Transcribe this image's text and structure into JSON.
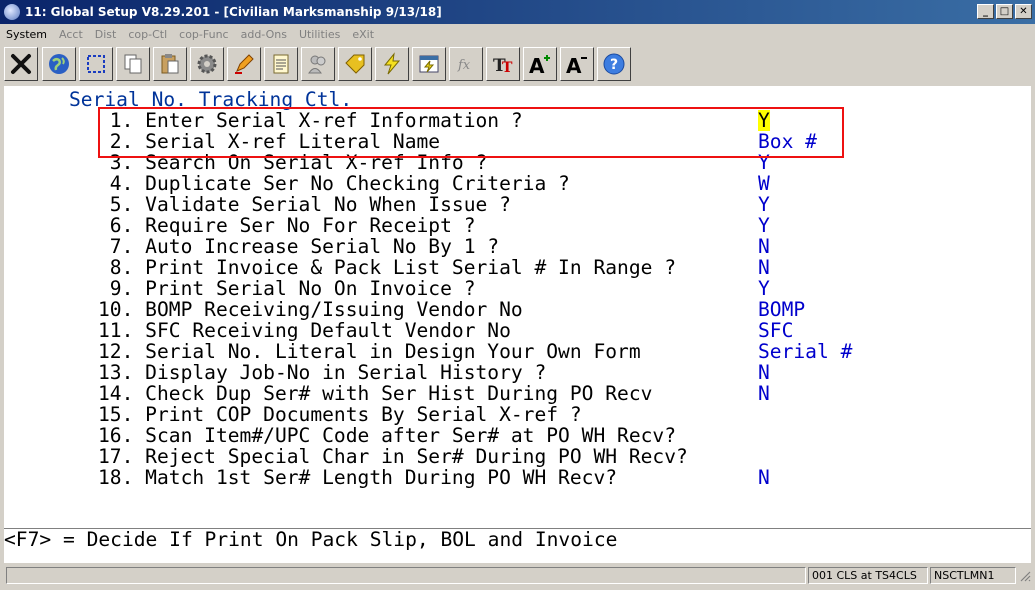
{
  "window": {
    "title": "11: Global Setup V8.29.201 - [Civilian Marksmanship 9/13/18]",
    "minimize_glyph": "_",
    "maximize_glyph": "□",
    "close_glyph": "✕"
  },
  "menu": [
    {
      "label": "System",
      "enabled": true
    },
    {
      "label": "Acct",
      "enabled": false
    },
    {
      "label": "Dist",
      "enabled": false
    },
    {
      "label": "cop-Ctl",
      "enabled": false
    },
    {
      "label": "cop-Func",
      "enabled": false
    },
    {
      "label": "add-Ons",
      "enabled": false
    },
    {
      "label": "Utilities",
      "enabled": false
    },
    {
      "label": "eXit",
      "enabled": false
    }
  ],
  "toolbar": [
    {
      "icon": "exit-x-icon"
    },
    {
      "icon": "globe-icon"
    },
    {
      "icon": "select-box-icon"
    },
    {
      "icon": "copy-pages-icon"
    },
    {
      "icon": "paste-clipboard-icon"
    },
    {
      "icon": "settings-gear-icon"
    },
    {
      "icon": "edit-pencil-icon"
    },
    {
      "icon": "notepad-icon"
    },
    {
      "icon": "users-group-icon"
    },
    {
      "icon": "tag-label-icon"
    },
    {
      "icon": "lightning-icon"
    },
    {
      "icon": "calendar-run-icon"
    },
    {
      "icon": "formula-fx-icon"
    },
    {
      "icon": "text-tt-icon"
    },
    {
      "icon": "font-increase-icon"
    },
    {
      "icon": "font-decrease-icon"
    },
    {
      "icon": "help-question-icon"
    }
  ],
  "screen": {
    "title": "Serial No. Tracking Ctl.",
    "items": [
      {
        "label": " 1. Enter Serial X-ref Information ?",
        "value": "Y"
      },
      {
        "label": " 2. Serial X-ref Literal Name",
        "value": "Box #"
      },
      {
        "label": " 3. Search On Serial X-ref Info ?",
        "value": "Y"
      },
      {
        "label": " 4. Duplicate Ser No Checking Criteria ?",
        "value": "W"
      },
      {
        "label": " 5. Validate Serial No When Issue ?",
        "value": "Y"
      },
      {
        "label": " 6. Require Ser No For Receipt ?",
        "value": "Y"
      },
      {
        "label": " 7. Auto Increase Serial No By 1 ?",
        "value": "N"
      },
      {
        "label": " 8. Print Invoice & Pack List Serial # In Range ?",
        "value": "N"
      },
      {
        "label": " 9. Print Serial No On Invoice ?",
        "value": "Y"
      },
      {
        "label": "10. BOMP Receiving/Issuing Vendor No",
        "value": "BOMP"
      },
      {
        "label": "11. SFC Receiving Default Vendor No",
        "value": "SFC"
      },
      {
        "label": "12. Serial No. Literal in Design Your Own Form",
        "value": "Serial #"
      },
      {
        "label": "13. Display Job-No in Serial History ?",
        "value": "N"
      },
      {
        "label": "14. Check Dup Ser# with Ser Hist During PO Recv",
        "value": "N"
      },
      {
        "label": "15. Print COP Documents By Serial X-ref ?",
        "value": ""
      },
      {
        "label": "16. Scan Item#/UPC Code after Ser# at PO WH Recv?",
        "value": ""
      },
      {
        "label": "17. Reject Special Char in Ser# During PO WH Recv?",
        "value": ""
      },
      {
        "label": "18. Match 1st Ser# Length During PO WH Recv?",
        "value": "N"
      }
    ],
    "help_line": "<F7> = Decide If Print On Pack Slip, BOL and Invoice"
  },
  "statusbar": {
    "session": "001 CLS at TS4CLS",
    "program": "NSCTLMN1"
  },
  "colors": {
    "title_blue": "#003399",
    "value_blue": "#0000cc",
    "cursor_yellow": "#ffff00",
    "highlight_red": "#ee1111"
  }
}
